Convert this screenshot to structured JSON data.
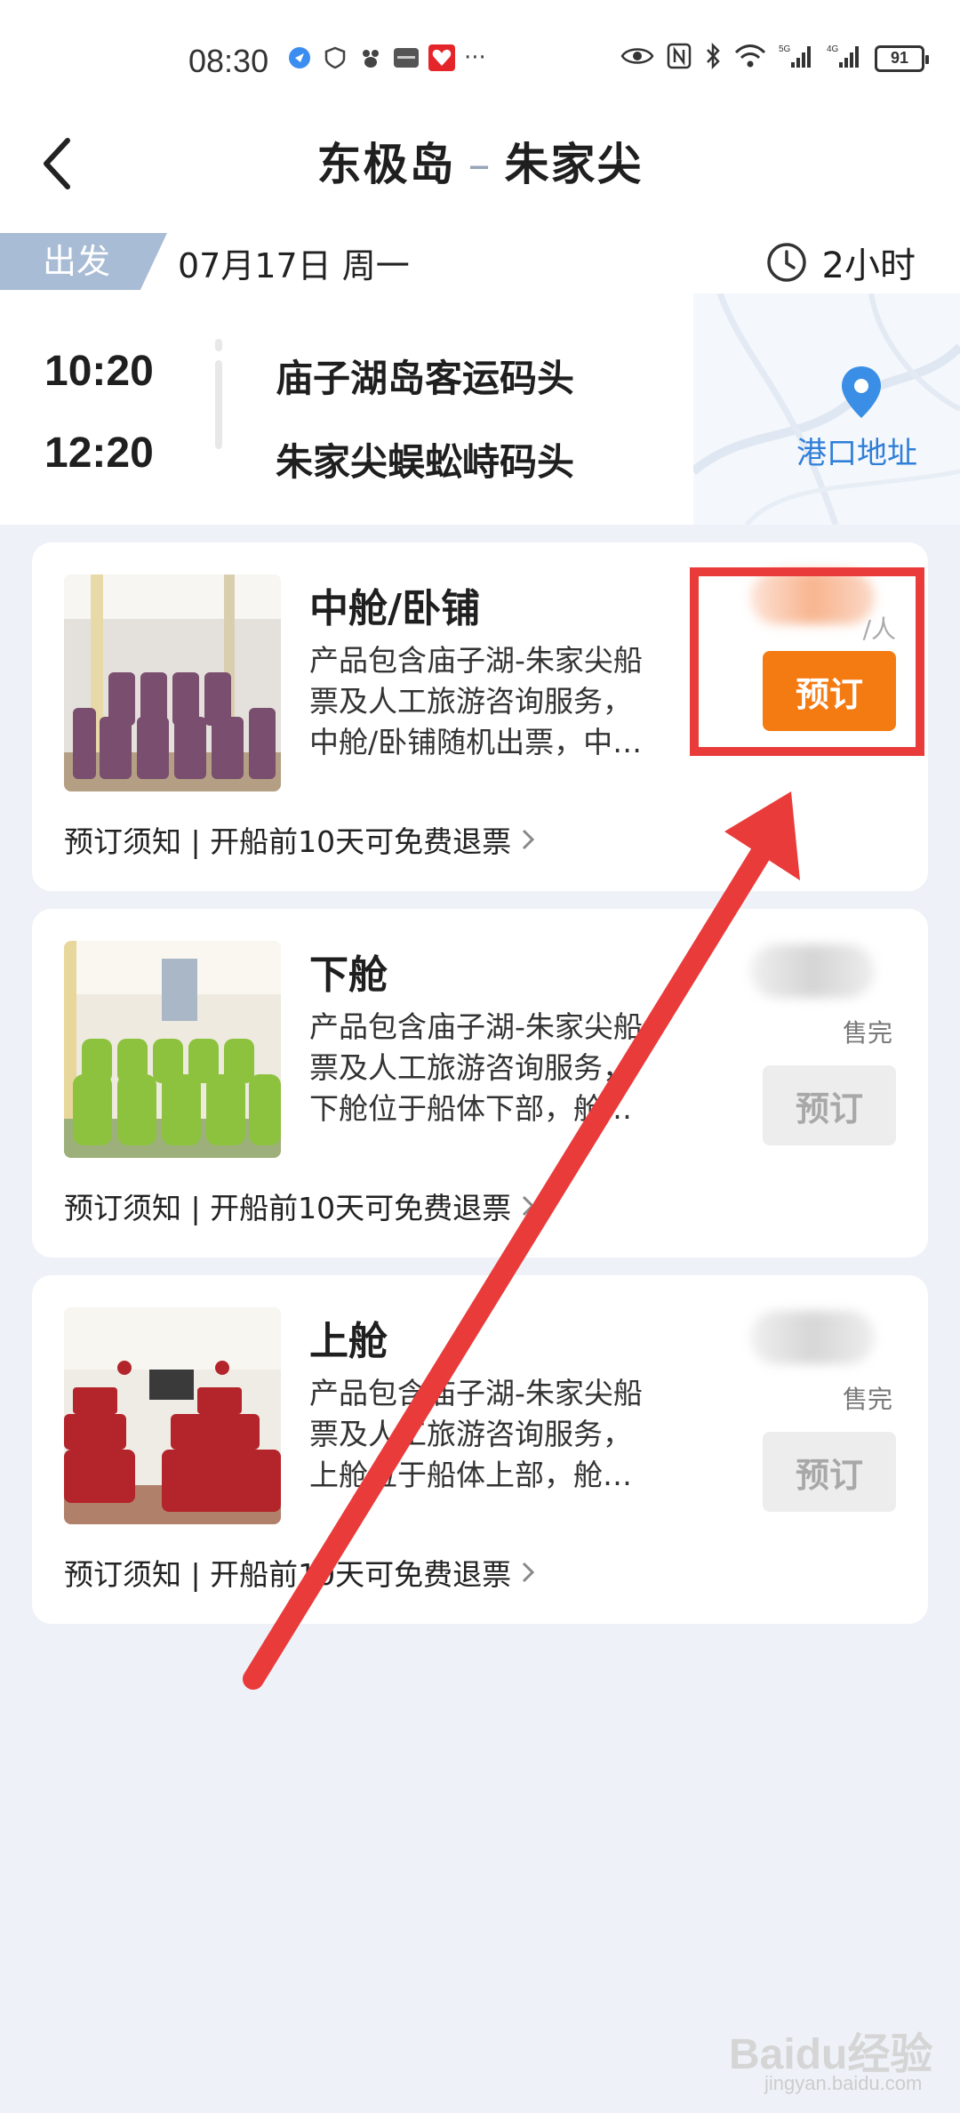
{
  "status_bar": {
    "time": "08:30",
    "dots": "···",
    "battery": "91",
    "left_icons": [
      "location-icon",
      "shield-icon",
      "paw-icon",
      "huawei-icon",
      "heart-app-icon"
    ],
    "right_icons": [
      "eye-icon",
      "nfc-icon",
      "bluetooth-icon",
      "wifi-icon",
      "signal-5g-icon",
      "signal-4g-icon"
    ]
  },
  "header": {
    "origin": "东极岛",
    "separator": "–",
    "destination": "朱家尖"
  },
  "trip": {
    "depart_label": "出发",
    "date": "07月17日  周一",
    "duration": "2小时",
    "depart_time": "10:20",
    "depart_port": "庙子湖岛客运码头",
    "arrive_time": "12:20",
    "arrive_port": "朱家尖蜈蚣峙码头",
    "map_label": "港口地址"
  },
  "cabins": [
    {
      "title": "中舱/卧铺",
      "desc": [
        "产品包含庙子湖-朱家尖船",
        "票及人工旅游咨询服务，",
        "中舱/卧铺随机出票，中…"
      ],
      "notice": "预订须知 | 开船前10天可免费退票",
      "price_unit": "/人",
      "status": "",
      "book_label": "预订"
    },
    {
      "title": "下舱",
      "desc": [
        "产品包含庙子湖-朱家尖船",
        "票及人工旅游咨询服务，",
        "下舱位于船体下部，舱…"
      ],
      "notice": "预订须知 | 开船前10天可免费退票",
      "price_unit": "",
      "status": "售完",
      "book_label": "预订"
    },
    {
      "title": "上舱",
      "desc": [
        "产品包含庙子湖-朱家尖船",
        "票及人工旅游咨询服务，",
        "上舱位于船体上部，舱…"
      ],
      "notice": "预订须知 | 开船前10天可免费退票",
      "price_unit": "",
      "status": "售完",
      "book_label": "预订"
    }
  ],
  "colors": {
    "accent_orange": "#f47a12",
    "annotation_red": "#ea3b3b",
    "map_blue": "#2f7fd8",
    "tag_blue": "#a9bcd5"
  },
  "watermark": {
    "brand": "Baidu经验",
    "url": "jingyan.baidu.com"
  }
}
